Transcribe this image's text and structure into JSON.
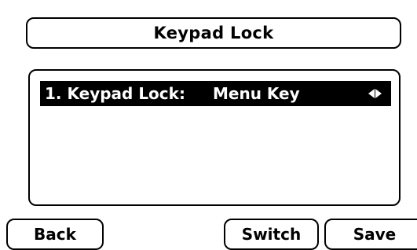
{
  "title": "Keypad Lock",
  "list": [
    {
      "label": "1. Keypad Lock:",
      "value": "Menu Key",
      "selected": true,
      "arrows_icon": "left-right-arrows-icon"
    }
  ],
  "softkeys": {
    "back": "Back",
    "switch": "Switch",
    "save": "Save"
  },
  "colors": {
    "background": "#ffffff",
    "foreground": "#000000",
    "highlight": "#000000",
    "highlight_text": "#ffffff"
  }
}
